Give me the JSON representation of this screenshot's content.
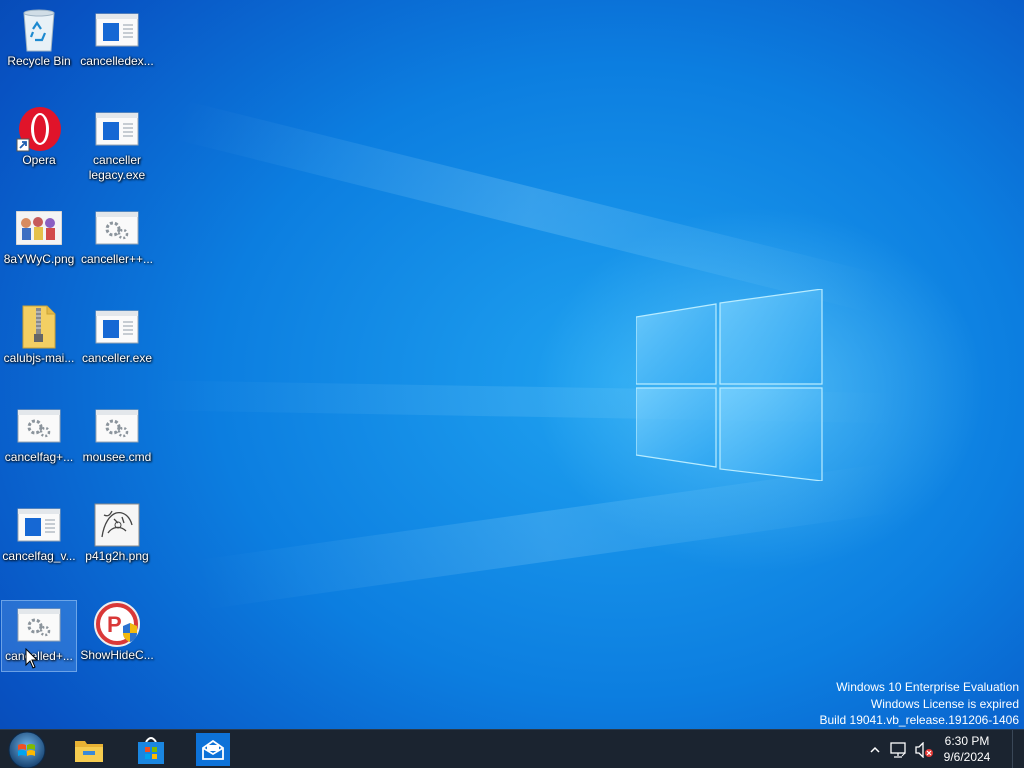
{
  "desktop": {
    "icons": [
      {
        "label": "Recycle Bin",
        "icon": "recycle-bin-icon"
      },
      {
        "label": "cancelledex...",
        "icon": "exe-window-icon"
      },
      {
        "label": "Opera",
        "icon": "opera-icon"
      },
      {
        "label": "canceller legacy.exe",
        "icon": "exe-window-icon"
      },
      {
        "label": "8aYWyC.png",
        "icon": "image-thumbnail-icon"
      },
      {
        "label": "canceller++...",
        "icon": "settings-file-icon"
      },
      {
        "label": "calubjs-mai...",
        "icon": "zip-folder-icon"
      },
      {
        "label": "canceller.exe",
        "icon": "exe-window-icon"
      },
      {
        "label": "cancelfag+...",
        "icon": "settings-file-icon"
      },
      {
        "label": "mousee.cmd",
        "icon": "settings-file-icon"
      },
      {
        "label": "cancelfag_v...",
        "icon": "exe-window-icon"
      },
      {
        "label": "p41g2h.png",
        "icon": "image-thumbnail-icon"
      },
      {
        "label": "cancelled+...",
        "icon": "settings-file-icon"
      },
      {
        "label": "ShowHideC...",
        "icon": "showhide-app-icon"
      }
    ]
  },
  "watermark": {
    "line1": "Windows 10 Enterprise Evaluation",
    "line2": "Windows License is expired",
    "line3": "Build 19041.vb_release.191206-1406"
  },
  "taskbar": {
    "pinned": [
      "file-explorer-icon",
      "store-icon",
      "mail-icon"
    ],
    "tray": {
      "chevron": "chevron-up-icon",
      "network": "network-icon",
      "volume": "volume-muted-icon"
    },
    "clock": {
      "time": "6:30 PM",
      "date": "9/6/2024"
    }
  },
  "colors": {
    "desktop_blue": "#0c7ee0",
    "taskbar": "#1b2430",
    "mail_accent": "#0d72d8"
  }
}
